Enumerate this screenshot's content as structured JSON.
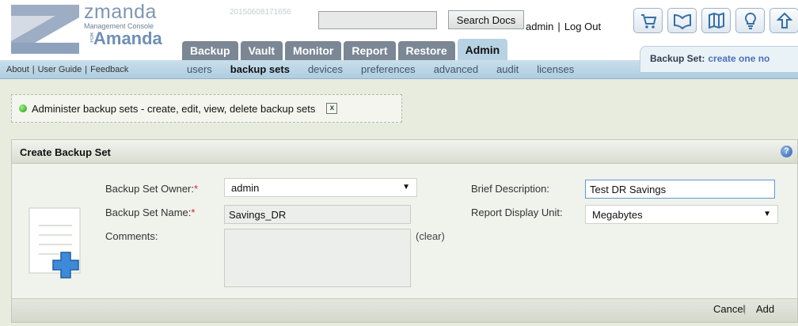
{
  "header": {
    "brand": "zmanda",
    "brand_sub": "Management Console",
    "brand_product": "Amanda",
    "brand_for": "FOR",
    "build_id": "20150608171656",
    "search": {
      "value": "",
      "button_label": "Search Docs"
    },
    "user": "admin",
    "logout_label": "Log Out",
    "separator": "|",
    "tool_icons": [
      "cart-icon",
      "book-icon",
      "map-icon",
      "bulb-icon",
      "arrow-icon"
    ]
  },
  "tabs": [
    {
      "label": "Backup",
      "active": false
    },
    {
      "label": "Vault",
      "active": false
    },
    {
      "label": "Monitor",
      "active": false
    },
    {
      "label": "Report",
      "active": false
    },
    {
      "label": "Restore",
      "active": false
    },
    {
      "label": "Admin",
      "active": true
    }
  ],
  "subnav": {
    "left_links": [
      "About",
      "User Guide",
      "Feedback"
    ],
    "items": [
      {
        "label": "users",
        "active": false
      },
      {
        "label": "backup sets",
        "active": true
      },
      {
        "label": "devices",
        "active": false
      },
      {
        "label": "preferences",
        "active": false
      },
      {
        "label": "advanced",
        "active": false
      },
      {
        "label": "audit",
        "active": false
      },
      {
        "label": "licenses",
        "active": false
      }
    ],
    "backup_set_label": "Backup Set:",
    "backup_set_value": "create one no"
  },
  "notice": {
    "text": "Administer backup sets - create, edit, view, delete backup sets",
    "close_label": "x"
  },
  "panel": {
    "title": "Create Backup Set",
    "help_label": "?",
    "owner_label": "Backup Set Owner:",
    "owner_value": "admin",
    "name_label": "Backup Set Name:",
    "name_value": "Savings_DR",
    "comments_label": "Comments:",
    "comments_value": "",
    "clear_label": "(clear)",
    "required_mark": "*",
    "desc_label": "Brief Description:",
    "desc_value": "Test DR Savings",
    "unit_label": "Report Display Unit:",
    "unit_value": "Megabytes",
    "cancel_label": "Cancel",
    "add_label": "Add"
  },
  "colors": {
    "tab_bg": "#7b8794",
    "tab_active_bg": "#b7d3e3",
    "subnav_bg": "#aecde0",
    "required": "#d7262b",
    "link": "#4d6fbd"
  }
}
